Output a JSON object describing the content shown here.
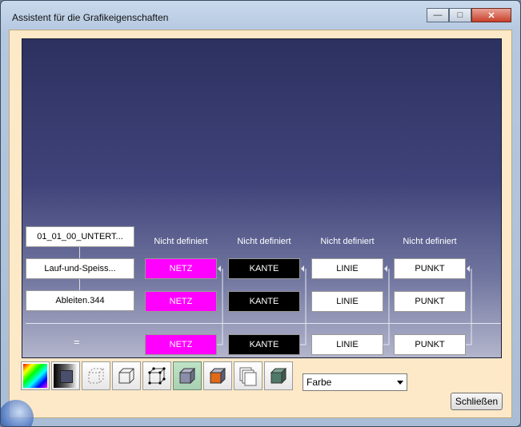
{
  "window": {
    "title": "Assistent für die Grafikeigenschaften",
    "controls": {
      "minimize": "—",
      "maximize": "□",
      "close": "✕"
    }
  },
  "graph": {
    "headers": [
      "Nicht definiert",
      "Nicht definiert",
      "Nicht definiert",
      "Nicht definiert"
    ],
    "tree": [
      "01_01_00_UNTERT...",
      "Lauf-und-Speiss...",
      "Ableiten.344",
      "="
    ],
    "rows": [
      [
        "NETZ",
        "KANTE",
        "LINIE",
        "PUNKT"
      ],
      [
        "NETZ",
        "KANTE",
        "LINIE",
        "PUNKT"
      ],
      [
        "NETZ",
        "KANTE",
        "LINIE",
        "PUNKT"
      ]
    ]
  },
  "toolbar": {
    "buttons": [
      {
        "name": "color-spectrum-icon"
      },
      {
        "name": "shaded-cube-icon"
      },
      {
        "name": "dashed-cube-icon"
      },
      {
        "name": "wire-cube-icon"
      },
      {
        "name": "vertex-cube-icon"
      },
      {
        "name": "solid-cube-icon"
      },
      {
        "name": "orange-face-cube-icon"
      },
      {
        "name": "layers-icon"
      },
      {
        "name": "green-cube-icon"
      }
    ],
    "dropdown_value": "Farbe"
  },
  "footer": {
    "close_label": "Schließen"
  },
  "colors": {
    "netz": "#ff00ff",
    "kante": "#000000",
    "background_top": "#2d3160"
  }
}
